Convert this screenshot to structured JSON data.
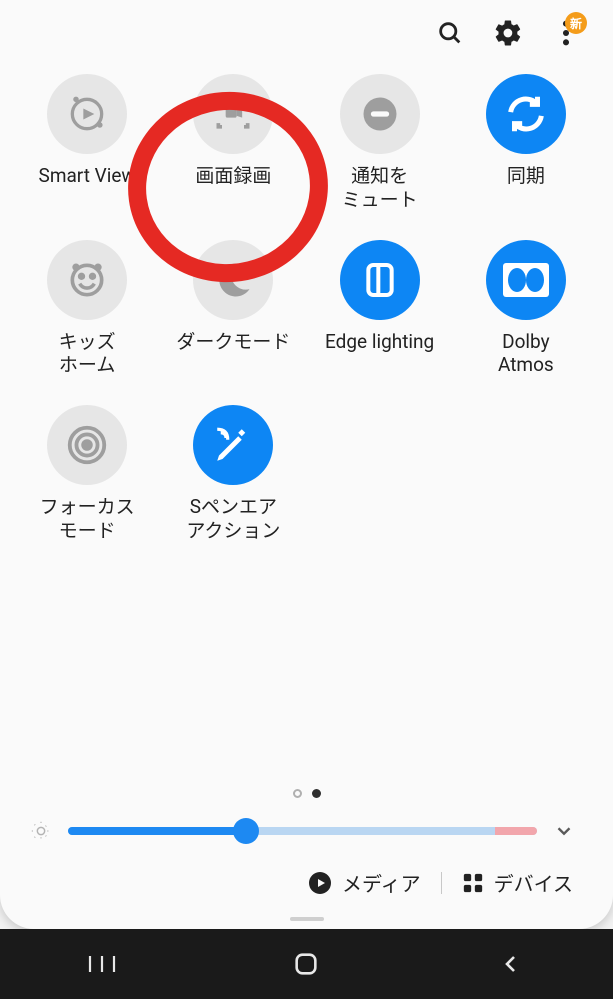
{
  "toolbar": {
    "badge_text": "新"
  },
  "tiles": [
    {
      "label": "Smart View",
      "state": "off",
      "icon": "smartview"
    },
    {
      "label": "画面録画",
      "state": "off",
      "icon": "screenrecord"
    },
    {
      "label": "通知を\nミュート",
      "state": "off",
      "icon": "mute"
    },
    {
      "label": "同期",
      "state": "on",
      "icon": "sync"
    },
    {
      "label": "キッズ\nホーム",
      "state": "off",
      "icon": "kids"
    },
    {
      "label": "ダークモード",
      "state": "off",
      "icon": "dark"
    },
    {
      "label": "Edge lighting",
      "state": "on",
      "icon": "edge"
    },
    {
      "label": "Dolby\nAtmos",
      "state": "on",
      "icon": "dolby"
    },
    {
      "label": "フォーカス\nモード",
      "state": "off",
      "icon": "focus"
    },
    {
      "label": "Sペンエア\nアクション",
      "state": "on",
      "icon": "spen"
    }
  ],
  "pager": {
    "total": 2,
    "active_index": 1
  },
  "brightness": {
    "percent": 38
  },
  "footer": {
    "media": "メディア",
    "devices": "デバイス"
  }
}
